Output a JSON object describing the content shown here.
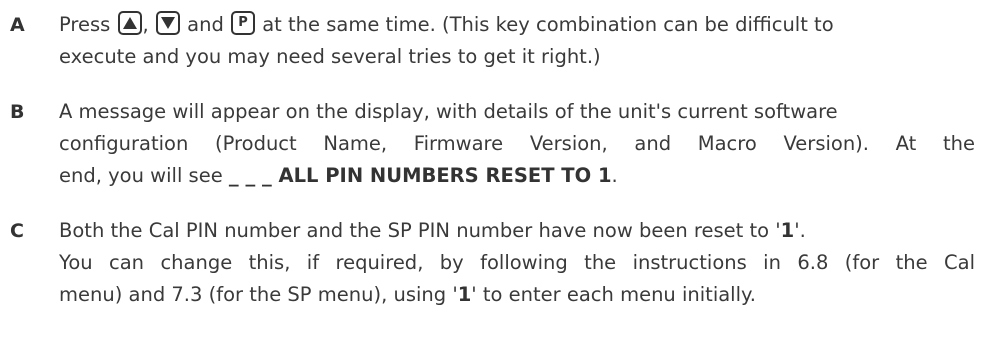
{
  "steps": [
    {
      "letter": "A",
      "press": "Press",
      "key_p": "P",
      "comma": ",",
      "and": "and",
      "rest_line1": "at the same time. (This key combination can be difficult to",
      "line2": "execute and you may need several tries to get it right.)"
    },
    {
      "letter": "B",
      "line1": "A message will appear on the display, with details of the unit's current software",
      "line2": "configuration (Product Name, Firmware Version, and Macro Version). At the",
      "line3_pre": "end, you will see ",
      "line3_bold": "_ _ _ ALL PIN NUMBERS RESET TO 1",
      "line3_post": "."
    },
    {
      "letter": "C",
      "line1_pre": "Both the Cal PIN number and the SP PIN number have now been reset to '",
      "line1_bold": "1",
      "line1_post": "'.",
      "line2": "You can change this, if required, by following the instructions in 6.8 (for the Cal",
      "line3_pre": "menu) and 7.3 (for the SP menu), using '",
      "line3_bold": "1",
      "line3_post": "' to enter each menu initially."
    }
  ],
  "keys": {
    "up": "up-arrow-icon",
    "down": "down-arrow-icon",
    "p": "P"
  }
}
